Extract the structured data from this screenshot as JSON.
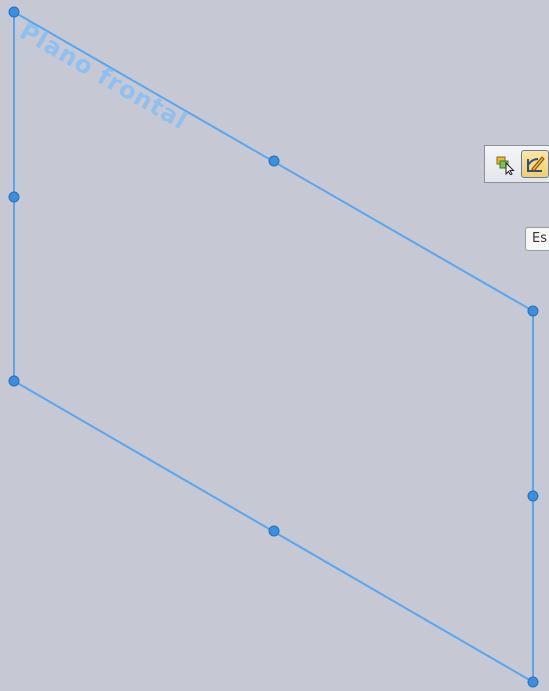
{
  "viewport": {
    "plane_label": "Plano frontal",
    "plane_color": "#5aa6ee",
    "handle_color": "#3a8fe0",
    "background_color": "#c6c9d3"
  },
  "context_toolbar": {
    "buttons": [
      {
        "icon": "select-other-icon"
      },
      {
        "icon": "sketch-icon"
      }
    ]
  },
  "tooltip": {
    "text": "Es"
  }
}
